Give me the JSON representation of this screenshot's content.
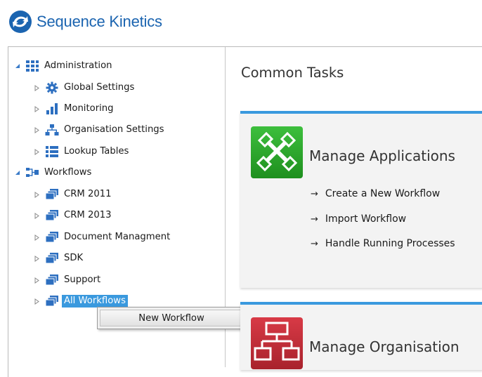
{
  "brand": {
    "name": "Sequence Kinetics",
    "color": "#1b64b0"
  },
  "tree": {
    "administration": {
      "label": "Administration",
      "expanded": true,
      "icon": "grid-icon"
    },
    "admin_items": [
      {
        "label": "Global Settings",
        "icon": "gear-icon"
      },
      {
        "label": "Monitoring",
        "icon": "bar-chart-icon"
      },
      {
        "label": "Organisation Settings",
        "icon": "org-chart-icon"
      },
      {
        "label": "Lookup Tables",
        "icon": "list-icon"
      }
    ],
    "workflows": {
      "label": "Workflows",
      "expanded": true,
      "icon": "workflow-icon"
    },
    "workflow_items": [
      {
        "label": "CRM 2011",
        "icon": "stack-icon"
      },
      {
        "label": "CRM 2013",
        "icon": "stack-icon"
      },
      {
        "label": "Document Managment",
        "icon": "stack-icon"
      },
      {
        "label": "SDK",
        "icon": "stack-icon"
      },
      {
        "label": "Support",
        "icon": "stack-icon"
      },
      {
        "label": "All Workflows",
        "icon": "stack-icon",
        "selected": true
      }
    ]
  },
  "context_menu": {
    "items": [
      "New Workflow"
    ]
  },
  "main": {
    "title": "Common Tasks",
    "cards": [
      {
        "title": "Manage Applications",
        "icon": "tools-icon",
        "icon_color": "#2aa02a",
        "tasks": [
          "Create a New Workflow",
          "Import Workflow",
          "Handle Running Processes"
        ]
      },
      {
        "title": "Manage Organisation",
        "icon": "org-icon",
        "icon_color": "#c5303b"
      }
    ]
  },
  "colors": {
    "accent": "#3a99de",
    "selection": "#3a99de"
  }
}
